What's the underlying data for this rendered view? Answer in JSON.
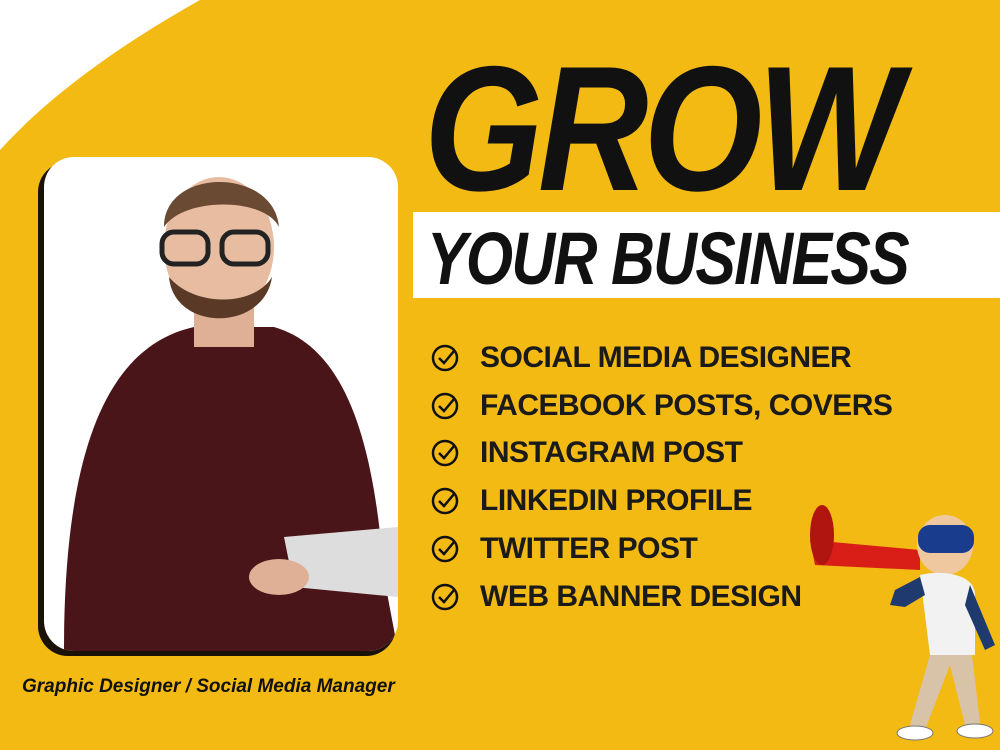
{
  "colors": {
    "accent": "#F2BA12",
    "text": "#111111",
    "background": "#FFFFFF",
    "megaphone": "#D91E18"
  },
  "headline": {
    "line1": "GROW",
    "line2": "YOUR BUSINESS"
  },
  "services": [
    {
      "icon": "check-circle-icon",
      "label": "SOCIAL MEDIA DESIGNER"
    },
    {
      "icon": "check-circle-icon",
      "label": "FACEBOOK POSTS, COVERS"
    },
    {
      "icon": "check-circle-icon",
      "label": "INSTAGRAM POST"
    },
    {
      "icon": "check-circle-icon",
      "label": "LINKEDIN PROFILE"
    },
    {
      "icon": "check-circle-icon",
      "label": "TWITTER POST"
    },
    {
      "icon": "check-circle-icon",
      "label": "WEB BANNER DESIGN"
    }
  ],
  "caption": "Graphic Designer / Social Media Manager"
}
